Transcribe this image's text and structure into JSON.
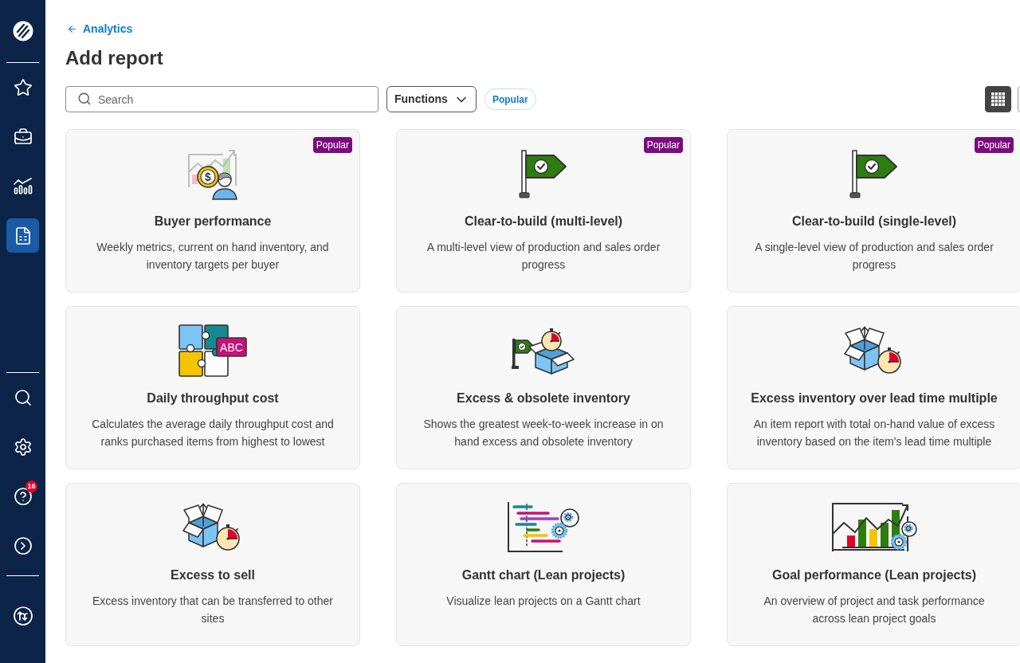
{
  "sidebar": {
    "top_items": [
      {
        "selected": false
      },
      {
        "selected": false
      },
      {
        "selected": false
      },
      {
        "selected": true
      }
    ],
    "bottom_items": [
      {
        "selected": false
      },
      {
        "selected": false
      },
      {
        "selected": false,
        "badge": "16"
      },
      {
        "selected": false
      }
    ],
    "footer_items": [
      {
        "selected": false
      }
    ]
  },
  "breadcrumb": {
    "label": "Analytics"
  },
  "title": "Add report",
  "toolbar": {
    "search": {
      "placeholder": "Search"
    },
    "functions_dropdown": {
      "label": "Functions"
    },
    "popular_filter": {
      "label": "Popular",
      "selected": false
    },
    "view_buttons": [
      {
        "selected": true
      },
      {
        "selected": false
      }
    ]
  },
  "cards": [
    {
      "kind": "buyer",
      "illustration_text": "$",
      "badge": "Popular",
      "title": "Buyer performance",
      "description": "Weekly metrics, current on hand inventory, and inventory targets per buyer"
    },
    {
      "kind": "flag",
      "badge": "Popular",
      "title": "Clear-to-build (multi-level)",
      "description": "A multi-level view of production and sales order progress"
    },
    {
      "kind": "flag",
      "badge": "Popular",
      "title": "Clear-to-build (single-level)",
      "description": "A single-level view of production and sales order progress"
    },
    {
      "kind": "puzzle",
      "illustration_text": "ABC",
      "title": "Daily throughput cost",
      "description": "Calculates the average daily throughput cost and ranks purchased items from highest to lowest"
    },
    {
      "kind": "box-flag-timer",
      "title": "Excess & obsolete inventory",
      "description": "Shows the greatest week-to-week increase in on hand excess and obsolete inventory"
    },
    {
      "kind": "box-timer",
      "title": "Excess inventory over lead time multiple",
      "description": "An item report with total on-hand value of excess inventory based on the item's lead time multiple"
    },
    {
      "kind": "box-timer",
      "title": "Excess to sell",
      "description": "Excess inventory that can be transferred to other sites"
    },
    {
      "kind": "gantt",
      "title": "Gantt chart (Lean projects)",
      "description": "Visualize lean projects on a Gantt chart"
    },
    {
      "kind": "goal-chart",
      "title": "Goal performance (Lean projects)",
      "description": "An overview of project and task performance across lean project goals"
    }
  ]
}
